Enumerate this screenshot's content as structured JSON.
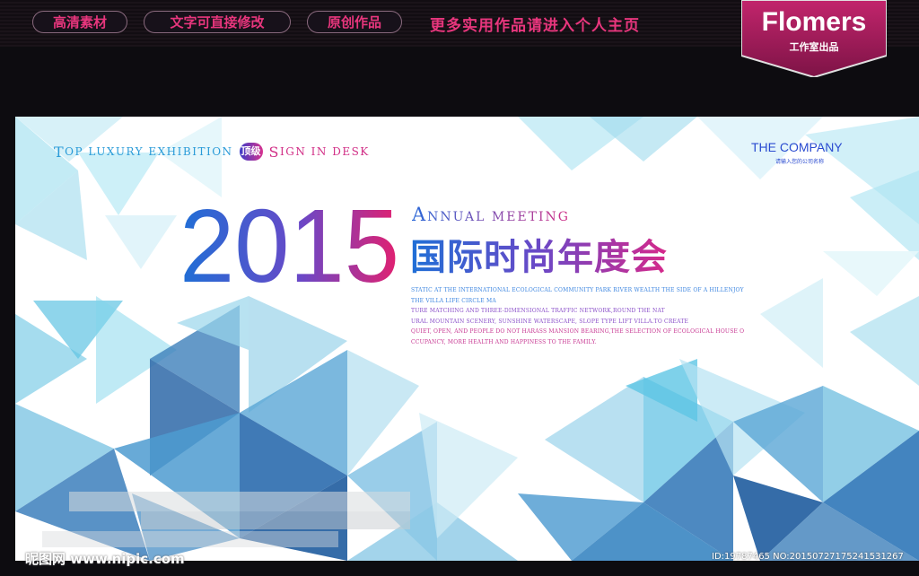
{
  "topbar": {
    "pills": [
      "高清素材",
      "文字可直接修改",
      "原创作品"
    ],
    "promo": "更多实用作品请进入个人主页",
    "brand": {
      "name": "Flomers",
      "sub": "工作室出品"
    }
  },
  "banner": {
    "tagline": {
      "part1_cap": "T",
      "part1": "OP LUXURY EXHIBITION",
      "badge": "顶级",
      "part2_cap": "S",
      "part2": "IGN IN DESK"
    },
    "company": {
      "name": "THE COMPANY",
      "sub": "请输入您的公司名称"
    },
    "year": "2015",
    "annual": {
      "cap": "A",
      "rest": "NNUAL MEETING"
    },
    "title_cn": "国际时尚年度会",
    "description": [
      "STATIC AT THE INTERNATIONAL ECOLOGICAL COMMUNITY PARK RIVER WEALTH THE SIDE OF A HILLENJOY",
      "THE VILLA LIFE CIRCLE MA",
      "TURE MATCHING AND THREE-DIMENSIONAL TRAFFIC NETWORK,ROUND THE NAT",
      "URAL MOUNTAIN SCENERY, SUNSHINE WATERSCAPE, SLOPE TYPE LIFT VILLA.TO CREATE",
      "QUIET, OPEN, AND PEOPLE DO NOT HARASS MANSION BEARING,THE SELECTION OF ECOLOGICAL HOUSE O",
      "CCUPANCY, MORE HEALTH AND HAPPINESS TO THE FAMILY."
    ],
    "colors": {
      "blue": "#1f6fd6",
      "purple": "#6a48c7",
      "magenta": "#d6288a",
      "cyan": "#7fd6ec"
    }
  },
  "footer": {
    "watermark": "昵图网 www.nipic.com",
    "image_id": "ID:19787465 NO:20150727175241531267"
  }
}
